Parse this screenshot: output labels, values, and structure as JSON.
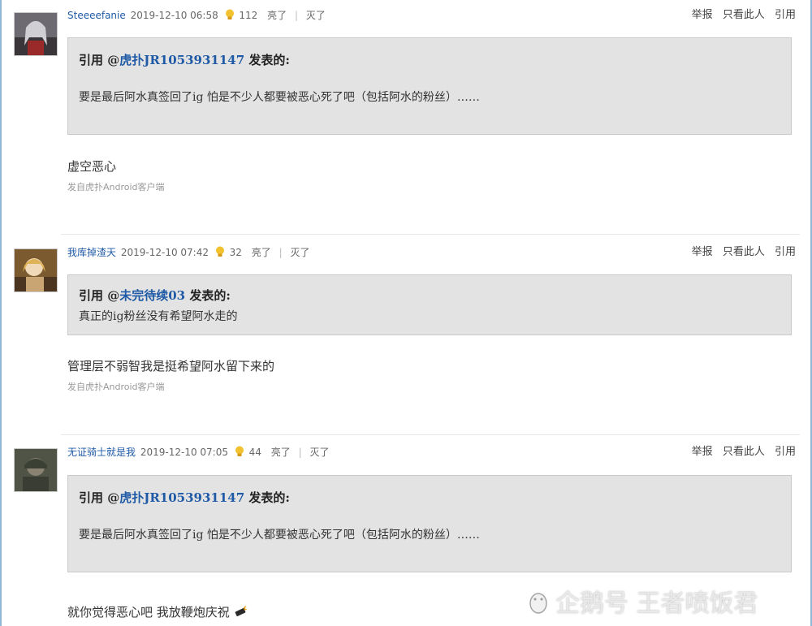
{
  "posts": [
    {
      "username": "Steeeefanie",
      "timestamp": "2019-12-10 06:58",
      "light_count": "112",
      "light_label": "亮了",
      "dark_label": "灭了",
      "actions": {
        "report": "举报",
        "only_this": "只看此人",
        "quote": "引用"
      },
      "quote": {
        "prefix": "引用 @",
        "user": "虎扑JR1053931147",
        "suffix": " 发表的:",
        "text": "要是最后阿水真签回了ig 怕是不少人都要被恶心死了吧（包括阿水的粉丝）……"
      },
      "reply": "虚空恶心",
      "source": "发自虎扑Android客户端"
    },
    {
      "username": "我库掉渣天",
      "timestamp": "2019-12-10 07:42",
      "light_count": "32",
      "light_label": "亮了",
      "dark_label": "灭了",
      "actions": {
        "report": "举报",
        "only_this": "只看此人",
        "quote": "引用"
      },
      "quote": {
        "prefix": "引用 @",
        "user": "未完待续03",
        "suffix": " 发表的:",
        "text": "真正的ig粉丝没有希望阿水走的"
      },
      "reply": "管理层不弱智我是挺希望阿水留下来的",
      "source": "发自虎扑Android客户端"
    },
    {
      "username": "无证骑士就是我",
      "timestamp": "2019-12-10 07:05",
      "light_count": "44",
      "light_label": "亮了",
      "dark_label": "灭了",
      "actions": {
        "report": "举报",
        "only_this": "只看此人",
        "quote": "引用"
      },
      "quote": {
        "prefix": "引用 @",
        "user": "虎扑JR1053931147",
        "suffix": " 发表的:",
        "text": "要是最后阿水真签回了ig 怕是不少人都要被恶心死了吧（包括阿水的粉丝）……"
      },
      "reply": "就你觉得恶心吧 我放鞭炮庆祝",
      "source": ""
    }
  ],
  "watermark": "企鹅号 王者喷饭君",
  "icons": {
    "light": "lightbulb-icon",
    "firecracker": "firecracker-icon",
    "watermark_logo": "penguin-icon"
  },
  "colors": {
    "link": "#1f5aa6",
    "quote_bg": "#e3e3e3",
    "frame": "#8fb7d8"
  }
}
